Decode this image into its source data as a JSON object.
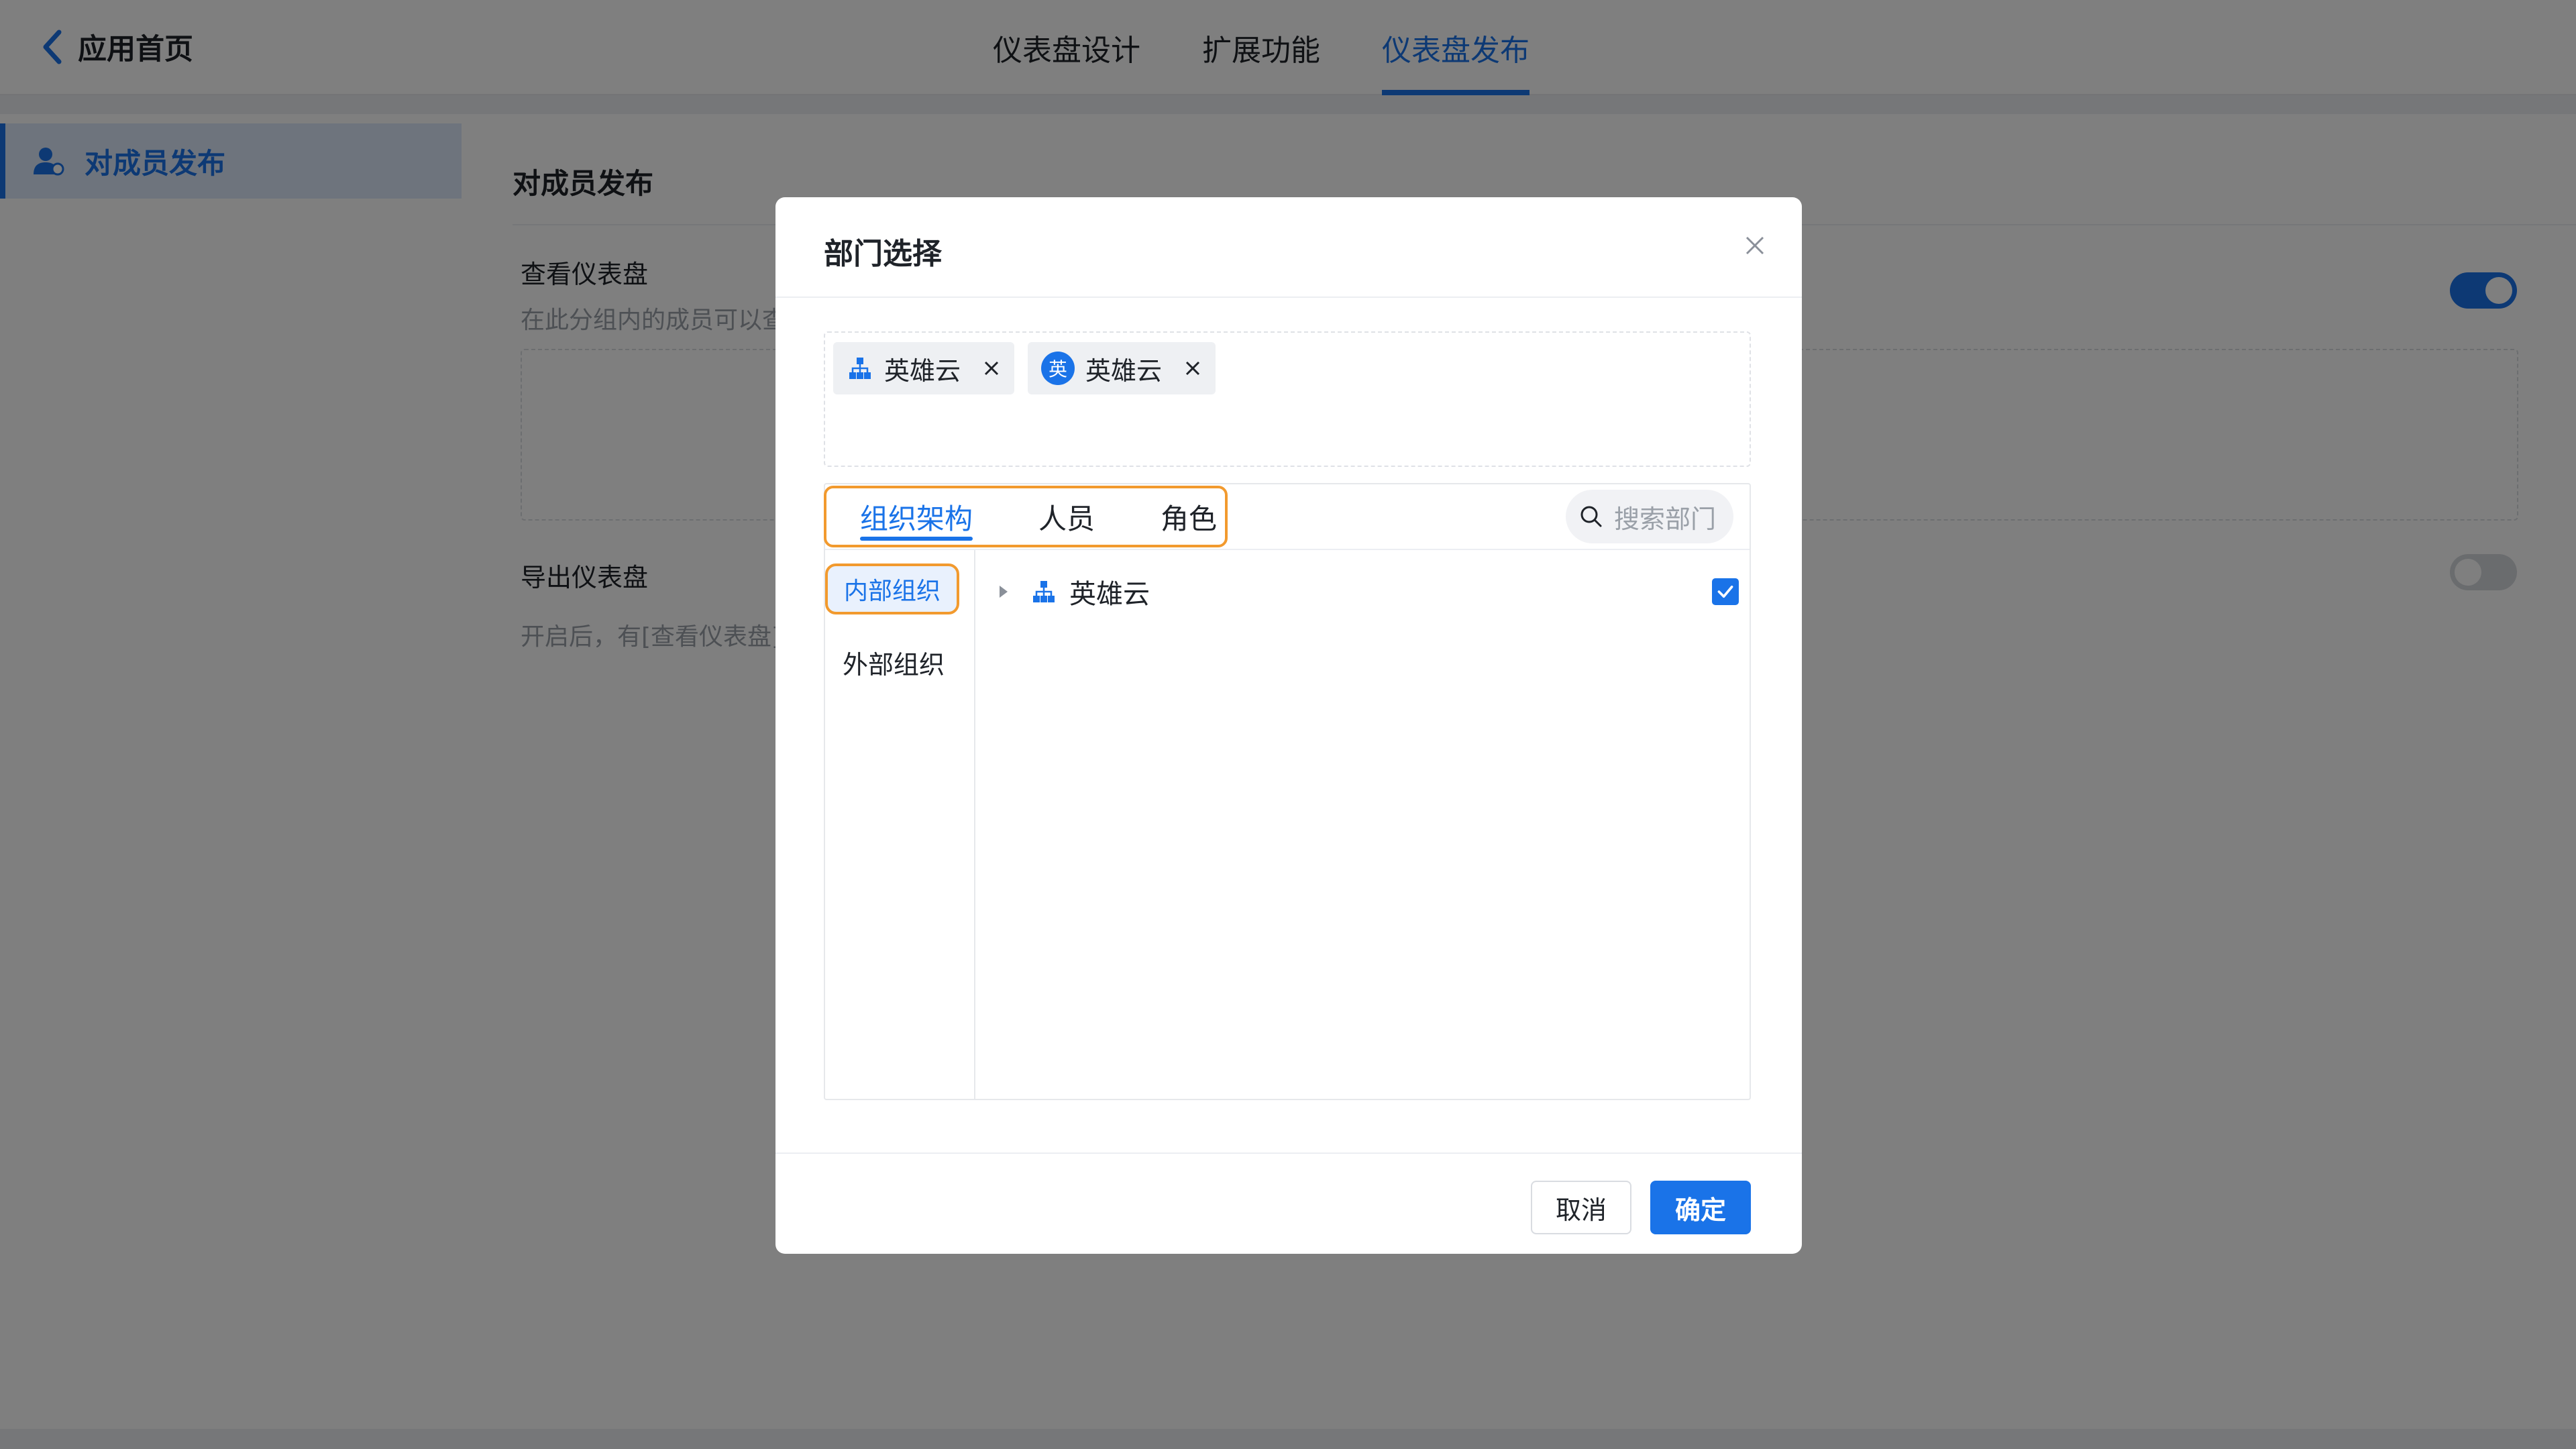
{
  "header": {
    "back_label": "应用首页",
    "tabs": [
      {
        "label": "仪表盘设计",
        "active": false
      },
      {
        "label": "扩展功能",
        "active": false
      },
      {
        "label": "仪表盘发布",
        "active": true
      }
    ]
  },
  "sidebar": {
    "items": [
      {
        "label": "对成员发布",
        "icon": "user-group-icon",
        "active": true
      }
    ]
  },
  "main": {
    "title": "对成员发布",
    "view_section": {
      "title": "查看仪表盘",
      "description": "在此分组内的成员可以查",
      "toggle_on": true
    },
    "export_section": {
      "title": "导出仪表盘",
      "description": "开启后，有[查看仪表盘]",
      "toggle_on": false
    }
  },
  "dialog": {
    "title": "部门选择",
    "selected_chips": [
      {
        "label": "英雄云",
        "icon": "org-icon"
      },
      {
        "label": "英雄云",
        "icon": "avatar-icon",
        "avatar_text": "英"
      }
    ],
    "tabs": [
      {
        "label": "组织架构",
        "active": true
      },
      {
        "label": "人员",
        "active": false
      },
      {
        "label": "角色",
        "active": false
      }
    ],
    "search_placeholder": "搜索部门",
    "org_types": [
      {
        "label": "内部组织",
        "active": true
      },
      {
        "label": "外部组织",
        "active": false
      }
    ],
    "tree": [
      {
        "label": "英雄云",
        "checked": true
      }
    ],
    "cancel_label": "取消",
    "ok_label": "确定"
  },
  "colors": {
    "accent": "#1a73e8",
    "highlight": "#f29a2e"
  }
}
